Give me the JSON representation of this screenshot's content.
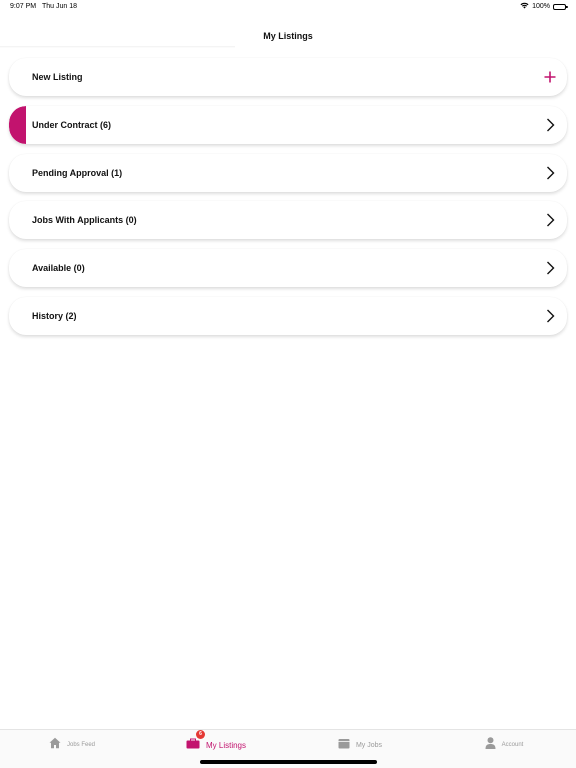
{
  "status_bar": {
    "time": "9:07 PM",
    "date": "Thu Jun 18",
    "battery": "100%"
  },
  "header": {
    "title": "My Listings"
  },
  "colors": {
    "accent": "#c2136e",
    "tab_inactive": "#9a9a9a",
    "badge": "#e53935"
  },
  "listings": [
    {
      "label": "New Listing",
      "trailing_icon": "plus-icon"
    },
    {
      "label": "Under Contract (6)",
      "trailing_icon": "chevron-right-icon",
      "accent": true
    },
    {
      "label": "Pending Approval (1)",
      "trailing_icon": "chevron-right-icon"
    },
    {
      "label": "Jobs With Applicants (0)",
      "trailing_icon": "chevron-right-icon"
    },
    {
      "label": "Available (0)",
      "trailing_icon": "chevron-right-icon"
    },
    {
      "label": "History (2)",
      "trailing_icon": "chevron-right-icon"
    }
  ],
  "tab_bar": {
    "tabs": [
      {
        "label": "Jobs Feed",
        "icon": "home-icon",
        "active": false
      },
      {
        "label": "My Listings",
        "icon": "briefcase-icon",
        "active": true,
        "badge": "6"
      },
      {
        "label": "My Jobs",
        "icon": "folder-icon",
        "active": false
      },
      {
        "label": "Account",
        "icon": "person-icon",
        "active": false
      }
    ]
  }
}
